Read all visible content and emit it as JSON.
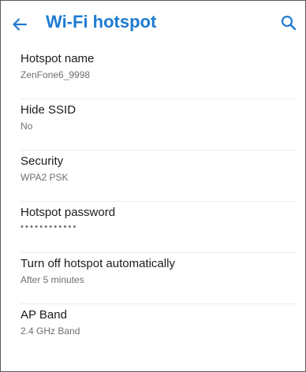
{
  "header": {
    "title": "Wi-Fi hotspot",
    "back_icon": "arrow-left-icon",
    "search_icon": "search-icon",
    "accent_color": "#1f7bd1"
  },
  "settings": [
    {
      "title": "Hotspot name",
      "value": "ZenFone6_9998"
    },
    {
      "title": "Hide SSID",
      "value": "No"
    },
    {
      "title": "Security",
      "value": "WPA2 PSK"
    },
    {
      "title": "Hotspot password",
      "value": "••••••••••••"
    },
    {
      "title": "Turn off hotspot automatically",
      "value": "After 5 minutes"
    },
    {
      "title": "AP Band",
      "value": "2.4 GHz Band"
    }
  ]
}
